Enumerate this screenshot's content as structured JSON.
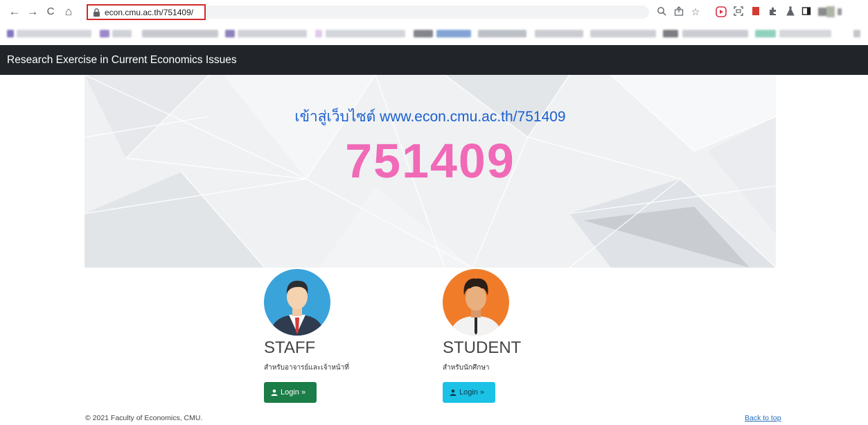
{
  "browser": {
    "url": "econ.cmu.ac.th/751409/",
    "nav": {
      "back": "←",
      "forward": "→",
      "reload": "C",
      "home": "⌂"
    },
    "icons": [
      "zoom-icon",
      "share-icon",
      "bookmark-star-icon",
      "extension-red-icon",
      "screenshot-icon",
      "extension-red2-icon",
      "puzzle-icon",
      "lab-icon",
      "sidebar-icon",
      "profile-avatar"
    ]
  },
  "site": {
    "title": "Research Exercise in Current Economics Issues"
  },
  "hero": {
    "subtitle": "เข้าสู่เว็บไซต์ www.econ.cmu.ac.th/751409",
    "code": "751409"
  },
  "roles": {
    "staff": {
      "title": "STAFF",
      "desc": "สำหรับอาจารย์และเจ้าหน้าที่",
      "login": "Login »"
    },
    "student": {
      "title": "STUDENT",
      "desc": "สำหรับนักศึกษา",
      "login": "Login »"
    }
  },
  "footer": {
    "copyright": "© 2021 Faculty of Economics, CMU.",
    "back_to_top": "Back to top"
  },
  "colors": {
    "header_bg": "#212529",
    "code": "#f06ab7",
    "subtitle": "#1a5fd0",
    "staff_btn": "#1b7d47",
    "student_btn": "#1bc2e6",
    "url_highlight": "#d22a2a"
  }
}
